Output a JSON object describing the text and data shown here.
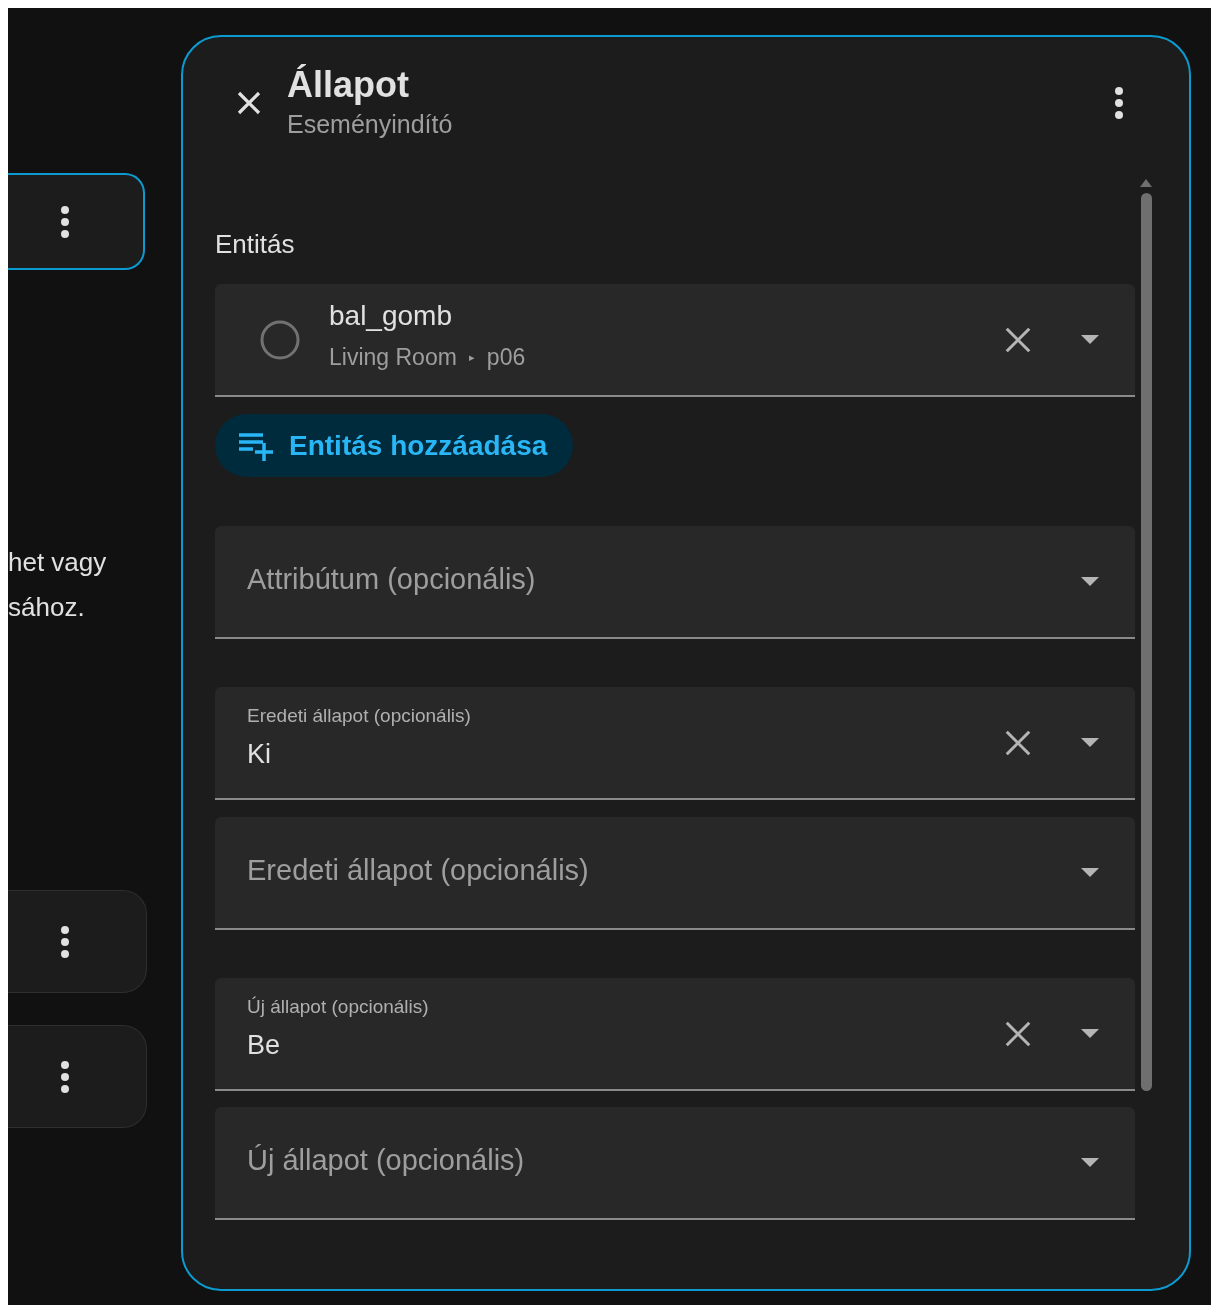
{
  "background": {
    "cards": [
      {
        "selected": true
      },
      {
        "selected": false
      },
      {
        "selected": false
      }
    ],
    "description_lines": [
      "het vagy",
      "sához."
    ]
  },
  "dialog": {
    "title": "Állapot",
    "subtitle": "Eseményindító",
    "entity_section": {
      "label": "Entitás",
      "entity": {
        "name": "bal_gomb",
        "area": "Living Room",
        "separator": "▸",
        "device": "p06"
      },
      "add_button": "Entitás hozzáadása"
    },
    "fields": [
      {
        "label": "Attribútum (opcionális)"
      },
      {
        "label": "Eredeti állapot (opcionális)",
        "value": "Ki"
      },
      {
        "label": "Eredeti állapot (opcionális)"
      },
      {
        "label": "Új állapot (opcionális)",
        "value": "Be"
      },
      {
        "label": "Új állapot (opcionális)"
      }
    ]
  }
}
